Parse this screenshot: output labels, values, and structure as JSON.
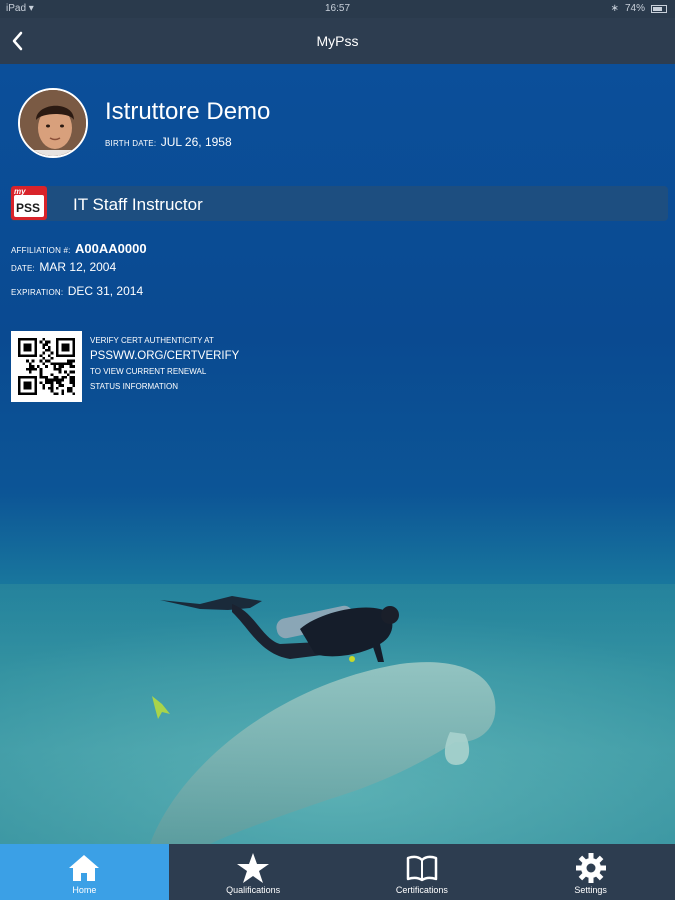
{
  "status_bar": {
    "device": "iPad",
    "time": "16:57",
    "battery": "74%",
    "battery_level": 0.74
  },
  "header": {
    "title": "MyPss",
    "back_icon": "chevron-left-icon"
  },
  "profile": {
    "name": "Istruttore Demo",
    "birth_label": "BIRTH DATE:",
    "birth_value": "JUL 26, 1958"
  },
  "certification": {
    "logo_text_top": "my",
    "logo_text_main": "PSS",
    "title": "IT Staff Instructor",
    "affiliation_label": "AFFILIATION #:",
    "affiliation_value": "A00AA0000",
    "date_label": "DATE:",
    "date_value": "MAR 12, 2004",
    "expiration_label": "EXPIRATION:",
    "expiration_value": "DEC 31, 2014"
  },
  "verify": {
    "line1": "VERIFY CERT AUTHENTICITY AT",
    "line2": "PSSWW.ORG/CERTVERIFY",
    "line3": "TO VIEW CURRENT RENEWAL",
    "line4": "STATUS INFORMATION"
  },
  "tabs": [
    {
      "label": "Home",
      "icon": "home-icon",
      "active": true
    },
    {
      "label": "Qualifications",
      "icon": "star-icon",
      "active": false
    },
    {
      "label": "Certifications",
      "icon": "book-icon",
      "active": false
    },
    {
      "label": "Settings",
      "icon": "gear-icon",
      "active": false
    }
  ],
  "colors": {
    "nav": "#2d3d50",
    "active_tab": "#3ba0e6",
    "ocean": "#0b4f9a",
    "cert_bar": "#1f4e7e"
  }
}
